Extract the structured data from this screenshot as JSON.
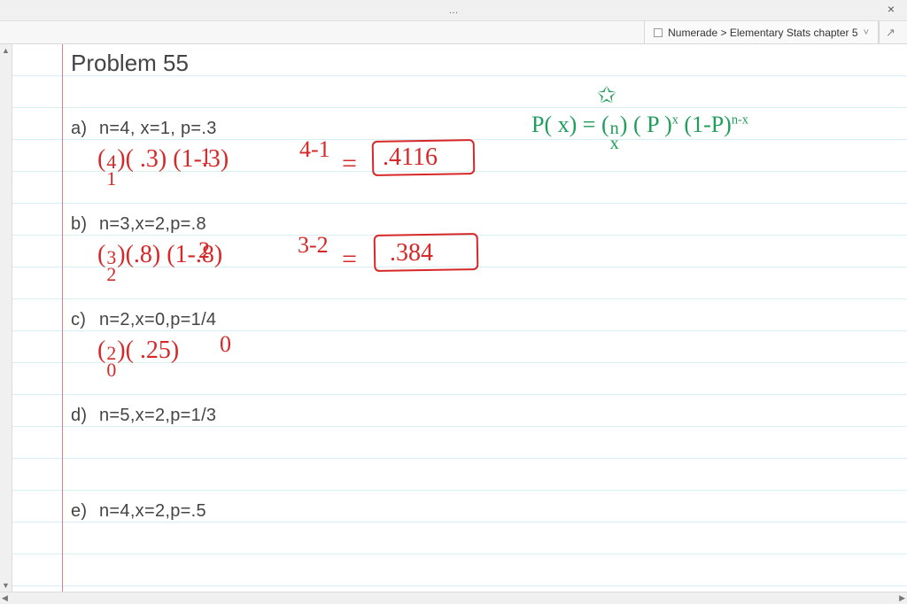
{
  "window": {
    "titlebar_label": "…",
    "close_label": "×"
  },
  "tab": {
    "label": "Numerade > Elementary Stats chapter 5",
    "chevron": "˅",
    "expand": "↗"
  },
  "scroll": {
    "up": "▲",
    "down": "▼",
    "left": "◀",
    "right": "▶"
  },
  "page": {
    "title": "Problem 55",
    "items": {
      "a": {
        "label": "a)",
        "params": "n=4, x=1, p=.3"
      },
      "b": {
        "label": "b)",
        "params": "n=3,x=2,p=.8"
      },
      "c": {
        "label": "c)",
        "params": "n=2,x=0,p=1/4"
      },
      "d": {
        "label": "d)",
        "params": "n=5,x=2,p=1/3"
      },
      "e": {
        "label": "e)",
        "params": "n=4,x=2,p=.5"
      }
    }
  },
  "handwriting": {
    "formula_lhs": "P( x) =",
    "formula_binom_top": "n",
    "formula_binom_bot": "x",
    "formula_rhs": "( P )",
    "formula_exp1": "x",
    "formula_q": "(1-P)",
    "formula_exp2": "n-x",
    "a_expr_open": "(",
    "a_binom_top": "4",
    "a_binom_bot": "1",
    "a_expr_rest": ")( .3) (1-.3)",
    "a_sup1": "1",
    "a_sup2": "4-1",
    "a_eq": "=",
    "a_ans": ".4116",
    "b_expr_open": "(",
    "b_binom_top": "3",
    "b_binom_bot": "2",
    "b_expr_rest": ")(.8) (1-.8)",
    "b_sup1": "2",
    "b_sup2": "3-2",
    "b_eq": "=",
    "b_ans": ".384",
    "c_expr_open": "(",
    "c_binom_top": "2",
    "c_binom_bot": "0",
    "c_expr_rest": ")( .25)",
    "c_sup1": "0",
    "star": "✩"
  }
}
